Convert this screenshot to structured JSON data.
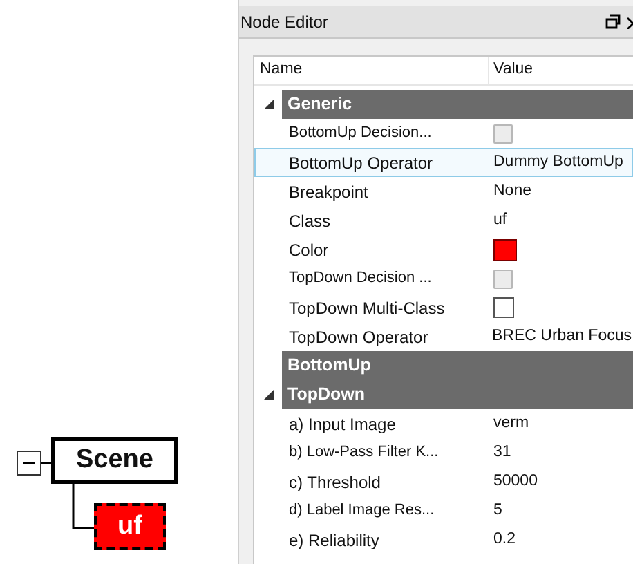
{
  "diagram": {
    "root": {
      "label": "Scene",
      "expanded": true,
      "children": [
        {
          "label": "uf",
          "color": "#ff0000"
        }
      ]
    }
  },
  "panel": {
    "title": "Node Editor",
    "grid": {
      "columns": [
        "Name",
        "Value"
      ],
      "categories": [
        {
          "label": "Generic",
          "expanded": true,
          "properties": [
            {
              "name": "BottomUp Decision...",
              "kind": "button",
              "selected": false
            },
            {
              "name": "BottomUp Operator",
              "kind": "text",
              "value": "Dummy BottomUp",
              "selected": true
            },
            {
              "name": "Breakpoint",
              "kind": "text",
              "value": "None",
              "selected": false
            },
            {
              "name": "Class",
              "kind": "text",
              "value": "uf",
              "selected": false
            },
            {
              "name": "Color",
              "kind": "color",
              "color": "#ff0000",
              "selected": false
            },
            {
              "name": "TopDown Decision ...",
              "kind": "button",
              "selected": false
            },
            {
              "name": "TopDown Multi-Class",
              "kind": "checkbox",
              "checked": false,
              "selected": false
            },
            {
              "name": "TopDown Operator",
              "kind": "text",
              "value": "BREC Urban Focus",
              "selected": false
            }
          ]
        },
        {
          "label": "BottomUp",
          "expanded": false
        },
        {
          "label": "TopDown",
          "expanded": true,
          "properties": [
            {
              "name": "a) Input Image",
              "kind": "text",
              "value": "verm",
              "selected": false
            },
            {
              "name": "b) Low-Pass Filter K...",
              "kind": "text",
              "value": "31",
              "selected": false
            },
            {
              "name": "c) Threshold",
              "kind": "text",
              "value": "50000",
              "selected": false
            },
            {
              "name": "d) Label Image Res...",
              "kind": "text",
              "value": "5",
              "selected": false
            },
            {
              "name": "e) Reliability",
              "kind": "text",
              "value": "0.2",
              "selected": false
            }
          ]
        }
      ]
    }
  }
}
